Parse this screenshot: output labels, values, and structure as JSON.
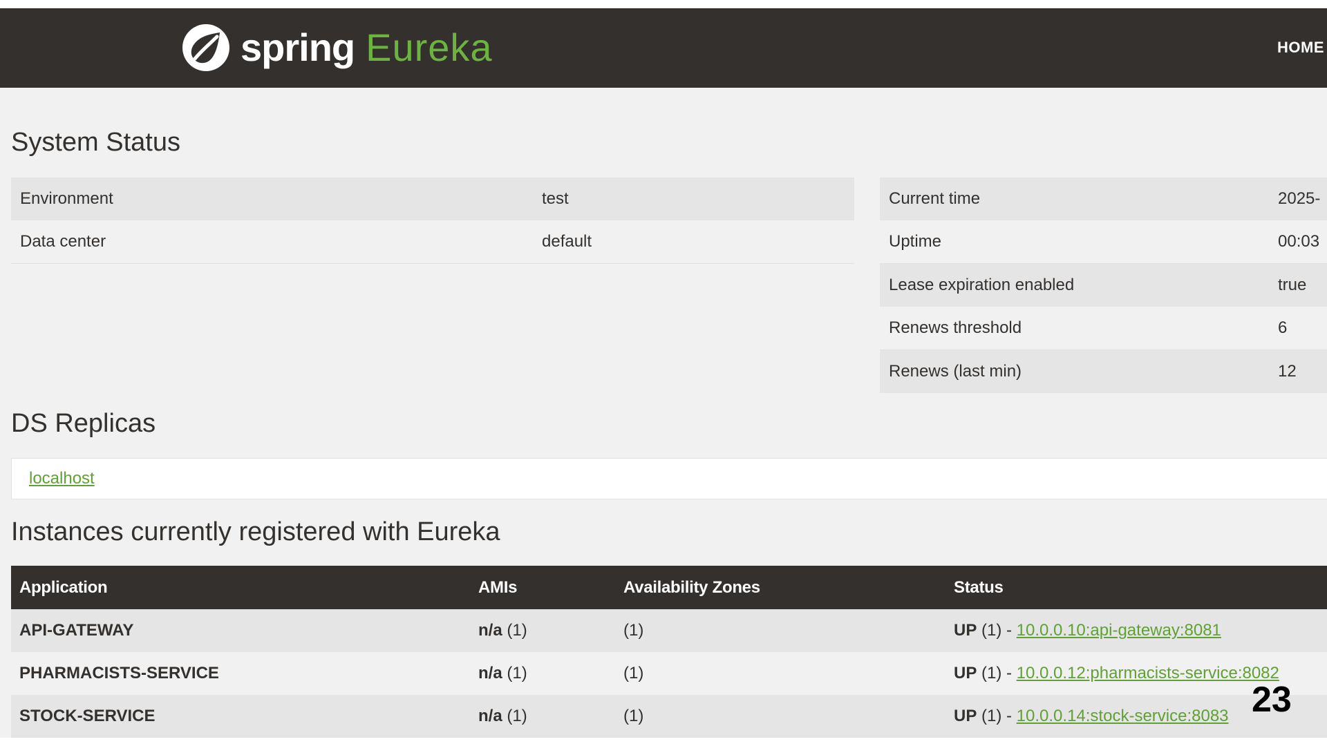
{
  "navbar": {
    "brand_spring": "spring",
    "brand_eureka": "Eureka",
    "home_label": "HOME",
    "logo_icon": "spring-leaf-icon"
  },
  "system_status": {
    "title": "System Status",
    "left": [
      {
        "label": "Environment",
        "value": "test"
      },
      {
        "label": "Data center",
        "value": "default"
      }
    ],
    "right": [
      {
        "label": "Current time",
        "value": "2025-"
      },
      {
        "label": "Uptime",
        "value": "00:03"
      },
      {
        "label": "Lease expiration enabled",
        "value": "true"
      },
      {
        "label": "Renews threshold",
        "value": "6"
      },
      {
        "label": "Renews (last min)",
        "value": "12"
      }
    ]
  },
  "ds_replicas": {
    "title": "DS Replicas",
    "link": "localhost"
  },
  "instances": {
    "title": "Instances currently registered with Eureka",
    "headers": [
      "Application",
      "AMIs",
      "Availability Zones",
      "Status"
    ],
    "rows": [
      {
        "app": "API-GATEWAY",
        "ami_bold": "n/a",
        "ami_count": " (1)",
        "zones": "(1)",
        "status_bold": "UP",
        "status_rest": " (1) - ",
        "link": "10.0.0.10:api-gateway:8081"
      },
      {
        "app": "PHARMACISTS-SERVICE",
        "ami_bold": "n/a",
        "ami_count": " (1)",
        "zones": "(1)",
        "status_bold": "UP",
        "status_rest": " (1) - ",
        "link": "10.0.0.12:pharmacists-service:8082"
      },
      {
        "app": "STOCK-SERVICE",
        "ami_bold": "n/a",
        "ami_count": " (1)",
        "zones": "(1)",
        "status_bold": "UP",
        "status_rest": " (1) - ",
        "link": "10.0.0.14:stock-service:8083"
      }
    ]
  },
  "slide_number": "23",
  "colors": {
    "navbar": "#34302d",
    "accent_green": "#6db33f",
    "link_green": "#5fa134",
    "background": "#f1f1f1"
  }
}
